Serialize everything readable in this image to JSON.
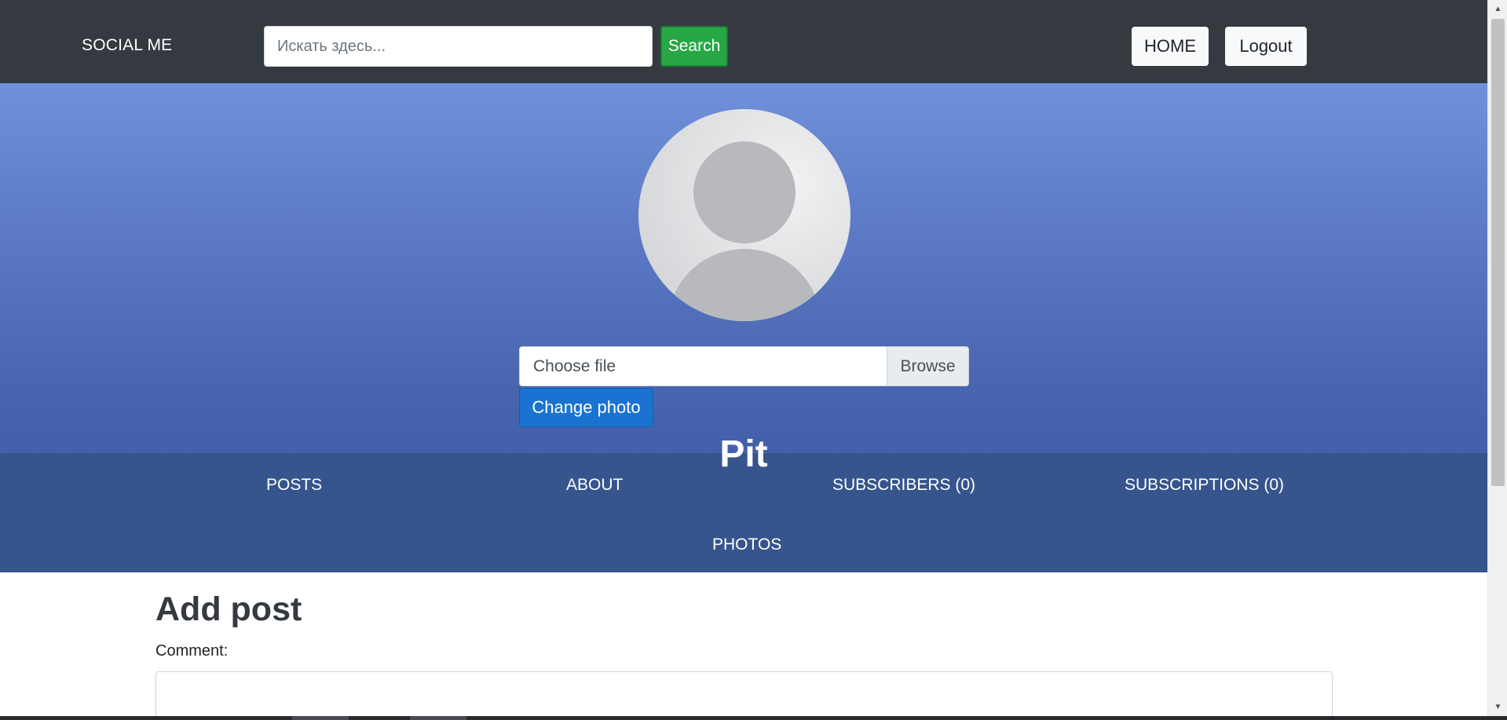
{
  "navbar": {
    "brand": "SOCIAL ME",
    "search_placeholder": "Искать здесь...",
    "search_button": "Search",
    "home_button": "HOME",
    "logout_button": "Logout",
    "background_color": "#343a40",
    "search_button_color": "#28a745"
  },
  "profile": {
    "name": "Pit",
    "file_input_label": "Choose file",
    "browse_button": "Browse",
    "change_photo_button": "Change photo",
    "avatar_icon": "default-user-avatar-icon",
    "accent_color": "#1a73d1"
  },
  "tabs": [
    {
      "label": "POSTS"
    },
    {
      "label": "ABOUT"
    },
    {
      "label": "SUBSCRIBERS (0)"
    },
    {
      "label": "SUBSCRIPTIONS (0)"
    },
    {
      "label": "PHOTOS"
    }
  ],
  "add_post": {
    "title": "Add post",
    "comment_label": "Comment:"
  },
  "scrollbar": {
    "up_icon": "scroll-up-arrow-icon",
    "down_icon": "scroll-down-arrow-icon"
  }
}
